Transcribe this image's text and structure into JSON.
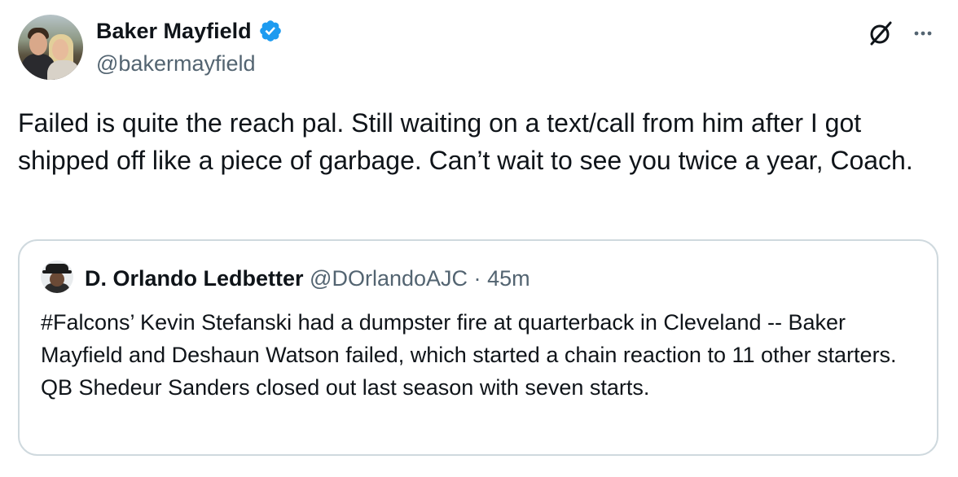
{
  "tweet": {
    "author": {
      "display_name": "Baker Mayfield",
      "handle": "@bakermayfield",
      "verified": true
    },
    "text": "Failed is quite the reach pal. Still waiting on a text/call from him after I got shipped off like a piece of garbage. Can’t wait to see you twice a year, Coach.",
    "icons": {
      "grok": "grok-icon",
      "more": "more-icon"
    },
    "colors": {
      "verified_blue": "#1d9bf0",
      "secondary_text": "#536471",
      "border": "#cfd9de"
    }
  },
  "quote": {
    "author": {
      "display_name": "D. Orlando Ledbetter",
      "handle": "@DOrlandoAJC"
    },
    "separator": "·",
    "time": "45m",
    "text": "#Falcons’ Kevin Stefanski had a dumpster fire at quarterback in Cleveland -- Baker Mayfield and Deshaun Watson failed, which started a chain reaction to 11 other starters. QB Shedeur Sanders closed out last season with seven starts."
  }
}
